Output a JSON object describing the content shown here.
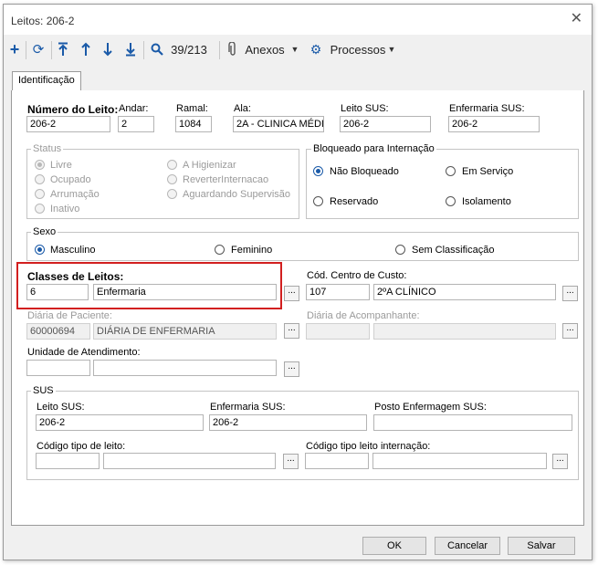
{
  "window": {
    "title": "Leitos: 206-2"
  },
  "toolbar": {
    "record_counter": "39/213",
    "anexos_label": "Anexos",
    "processos_label": "Processos"
  },
  "tabs": [
    {
      "label": "Identificação"
    }
  ],
  "form": {
    "numero_leito": {
      "label": "Número do Leito:",
      "value": "206-2"
    },
    "andar": {
      "label": "Andar:",
      "value": "2"
    },
    "ramal": {
      "label": "Ramal:",
      "value": "1084"
    },
    "ala": {
      "label": "Ala:",
      "value": "2A - CLINICA MÉDI"
    },
    "leito_sus": {
      "label": "Leito SUS:",
      "value": "206-2"
    },
    "enfermaria_sus": {
      "label": "Enfermaria SUS:",
      "value": "206-2"
    },
    "status": {
      "title": "Status",
      "options": [
        "Livre",
        "Ocupado",
        "Arrumação",
        "Inativo",
        "A Higienizar",
        "ReverterInternacao",
        "Aguardando Supervisão"
      ],
      "selected": "Livre"
    },
    "bloqueado": {
      "title": "Bloqueado para Internação",
      "options": [
        "Não Bloqueado",
        "Em Serviço",
        "Reservado",
        "Isolamento"
      ],
      "selected": "Não Bloqueado"
    },
    "sexo": {
      "title": "Sexo",
      "options": [
        "Masculino",
        "Feminino",
        "Sem Classificação"
      ],
      "selected": "Masculino"
    },
    "classes_leitos": {
      "label": "Classes de Leitos:",
      "code": "6",
      "name": "Enfermaria"
    },
    "centro_custo": {
      "label": "Cód. Centro de Custo:",
      "code": "107",
      "name": "2ºA CLÍNICO"
    },
    "diaria_paciente": {
      "label": "Diária de Paciente:",
      "code": "60000694",
      "name": "DIÁRIA DE  ENFERMARIA"
    },
    "diaria_acompanhante": {
      "label": "Diária de Acompanhante:",
      "code": "",
      "name": ""
    },
    "unidade_atendimento": {
      "label": "Unidade de Atendimento:",
      "code": "",
      "name": ""
    },
    "sus": {
      "title": "SUS",
      "leito_sus": {
        "label": "Leito SUS:",
        "value": "206-2"
      },
      "enfermaria_sus": {
        "label": "Enfermaria SUS:",
        "value": "206-2"
      },
      "posto_enfermagem": {
        "label": "Posto Enfermagem SUS:",
        "value": ""
      },
      "codigo_tipo_leito": {
        "label": "Código tipo de leito:",
        "code": "",
        "name": ""
      },
      "codigo_tipo_internacao": {
        "label": "Código tipo leito internação:",
        "code": "",
        "name": ""
      }
    }
  },
  "dots_label": "...",
  "buttons": {
    "ok": "OK",
    "cancel": "Cancelar",
    "save": "Salvar"
  },
  "colors": {
    "accent": "#1a5aa8",
    "highlight": "#d21f1f"
  }
}
